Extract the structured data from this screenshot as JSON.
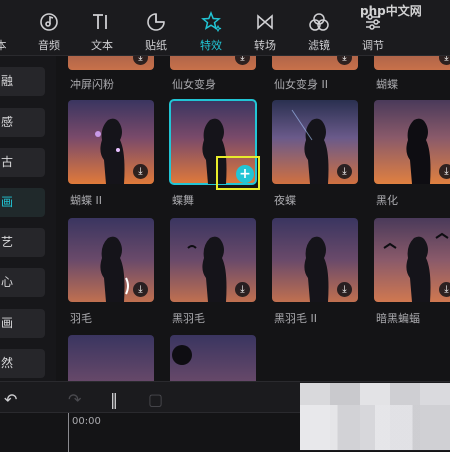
{
  "toolbar": {
    "items": [
      {
        "label": "本",
        "icon": "partial-icon"
      },
      {
        "label": "音频",
        "icon": "music-icon"
      },
      {
        "label": "文本",
        "icon": "text-icon"
      },
      {
        "label": "贴纸",
        "icon": "sticker-icon"
      },
      {
        "label": "特效",
        "icon": "sparkle-icon",
        "active": true
      },
      {
        "label": "转场",
        "icon": "bowtie-icon"
      },
      {
        "label": "滤镜",
        "icon": "filter-icon"
      },
      {
        "label": "调节",
        "icon": "sliders-icon"
      }
    ]
  },
  "categories": [
    "融",
    "感",
    "古",
    "画",
    "艺",
    "心",
    "画",
    "然"
  ],
  "active_category": 3,
  "effects": {
    "row0": [
      "冲屏闪粉",
      "仙女变身",
      "仙女变身 II",
      "蝴蝶"
    ],
    "row1": [
      "蝴蝶 II",
      "蝶舞",
      "夜蝶",
      "黑化"
    ],
    "row2": [
      "羽毛",
      "黑羽毛",
      "黑羽毛 II",
      "暗黑蝙蝠"
    ]
  },
  "timeline": {
    "timecode": "00:00"
  },
  "watermark": "php中文网",
  "colors": {
    "accent": "#22c5d5",
    "highlight": "#e8ec2a"
  }
}
